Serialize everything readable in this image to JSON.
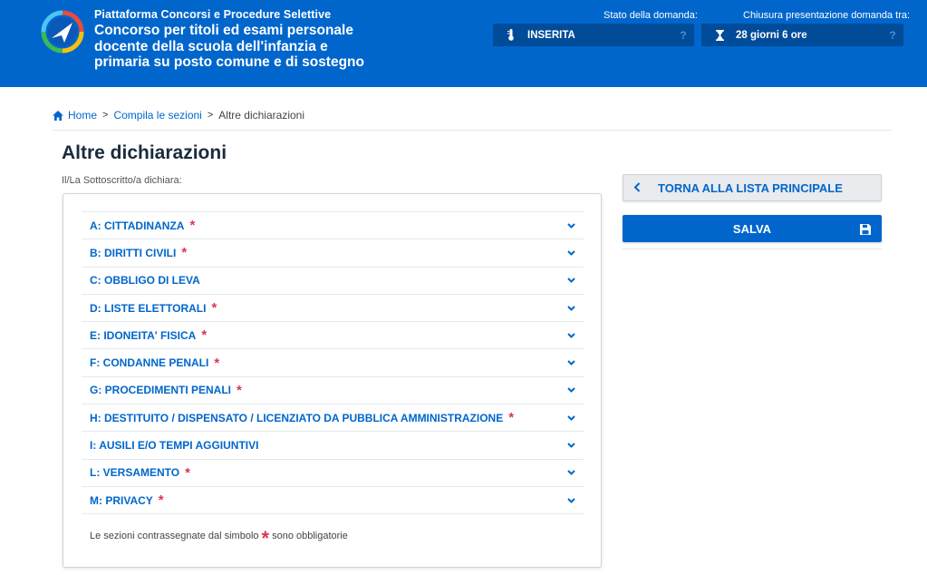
{
  "header": {
    "platform": "Piattaforma Concorsi e Procedure Selettive",
    "title": "Concorso per titoli ed esami personale docente della scuola dell'infanzia e primaria su posto comune e di sostegno",
    "status_label": "Stato della domanda:",
    "status_value": "INSERITA",
    "status_icon": "thermometer-icon",
    "deadline_label": "Chiusura presentazione domanda tra:",
    "deadline_value": "28 giorni 6 ore",
    "deadline_icon": "hourglass-icon",
    "help": "?"
  },
  "breadcrumb": {
    "home": "Home",
    "separator": ">",
    "sections": "Compila le sezioni",
    "current": "Altre dichiarazioni"
  },
  "page": {
    "title": "Altre dichiarazioni",
    "subtitle": "Il/La Sottoscritto/a dichiara:"
  },
  "sections": [
    {
      "label": "A: CITTADINANZA",
      "required": true
    },
    {
      "label": "B: DIRITTI CIVILI",
      "required": true
    },
    {
      "label": "C: OBBLIGO DI LEVA",
      "required": false
    },
    {
      "label": "D: LISTE ELETTORALI",
      "required": true
    },
    {
      "label": "E: IDONEITA' FISICA",
      "required": true
    },
    {
      "label": "F: CONDANNE PENALI",
      "required": true
    },
    {
      "label": "G: PROCEDIMENTI PENALI",
      "required": true
    },
    {
      "label": "H: DESTITUITO / DISPENSATO / LICENZIATO DA PUBBLICA AMMINISTRAZIONE",
      "required": true
    },
    {
      "label": "I: AUSILI E/O TEMPI AGGIUNTIVI",
      "required": false
    },
    {
      "label": "L: VERSAMENTO",
      "required": true
    },
    {
      "label": "M: PRIVACY",
      "required": true
    }
  ],
  "required_symbol": "*",
  "legend": {
    "before": "Le sezioni contrassegnate dal simbolo",
    "after": "sono obbligatorie"
  },
  "actions": {
    "back_label": "TORNA ALLA LISTA PRINCIPALE",
    "back_icon": "chevron-left-icon",
    "save_label": "SALVA",
    "save_icon": "floppy-disk-icon"
  },
  "colors": {
    "primary": "#0066cc",
    "header_dark": "#004c99",
    "required": "#d9364f"
  }
}
